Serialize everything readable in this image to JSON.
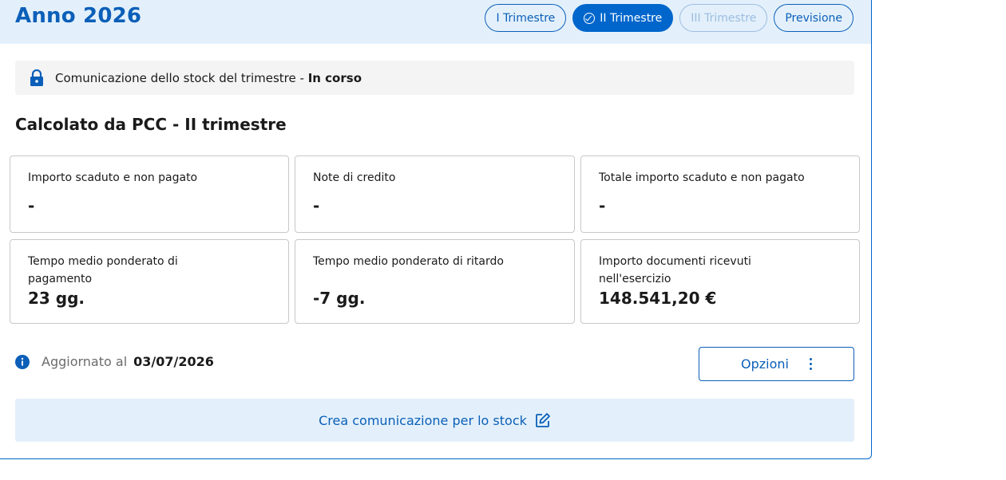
{
  "header": {
    "title": "Anno 2026",
    "tabs": [
      {
        "label": "I Trimestre",
        "state": "default"
      },
      {
        "label": "II Trimestre",
        "state": "active"
      },
      {
        "label": "III Trimestre",
        "state": "disabled"
      },
      {
        "label": "Previsione",
        "state": "default"
      }
    ]
  },
  "status": {
    "text": "Comunicazione dello stock del trimestre - ",
    "state": "In corso",
    "icon": "lock-icon"
  },
  "section": {
    "title": "Calcolato da PCC - II trimestre"
  },
  "cards": [
    {
      "label": "Importo scaduto e non pagato",
      "value": "-"
    },
    {
      "label": "Note di credito",
      "value": "-"
    },
    {
      "label": "Totale importo scaduto e non pagato",
      "value": "-"
    },
    {
      "label": "Tempo medio ponderato di pagamento",
      "value": "23 gg."
    },
    {
      "label": "Tempo medio ponderato di ritardo",
      "value": "-7 gg."
    },
    {
      "label": "Importo documenti ricevuti nell'esercizio",
      "value": "148.541,20 €"
    }
  ],
  "update": {
    "label": "Aggiornato al",
    "date": "03/07/2026",
    "icon": "info-icon"
  },
  "actions": {
    "options_label": "Opzioni",
    "create_label": "Crea comunicazione per lo stock"
  },
  "colors": {
    "primary": "#0066cc",
    "header_bg": "#e3f0fb",
    "status_bg": "#f4f4f5"
  }
}
